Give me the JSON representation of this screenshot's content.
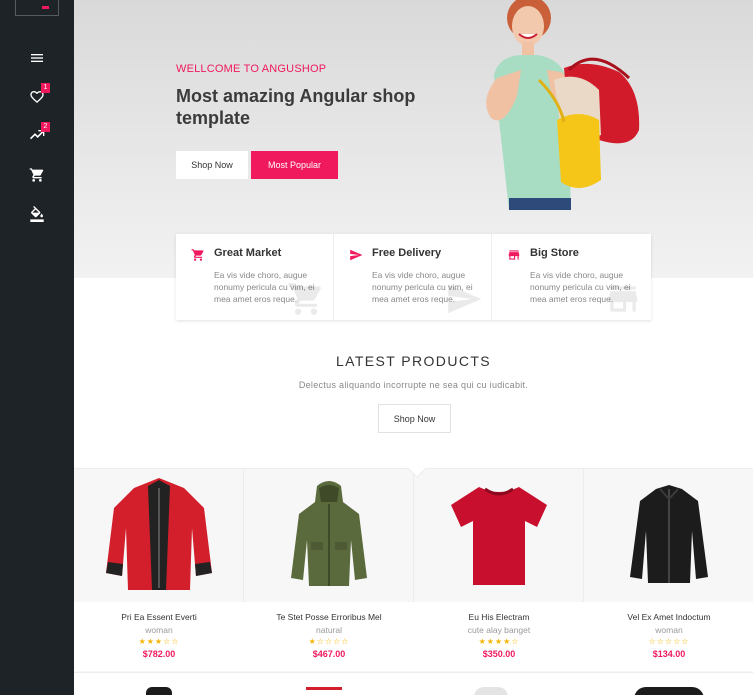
{
  "sidebar": {
    "items": [
      {
        "icon": "menu-icon"
      },
      {
        "icon": "heart-icon",
        "badge": "1"
      },
      {
        "icon": "trending-icon",
        "badge": "2"
      },
      {
        "icon": "cart-icon"
      },
      {
        "icon": "paint-bucket-icon"
      }
    ]
  },
  "hero": {
    "kicker": "WELLCOME TO ANGUSHOP",
    "title": "Most amazing Angular shop template",
    "btn_shop_now": "Shop Now",
    "btn_most_popular": "Most Popular"
  },
  "features": [
    {
      "icon": "cart-icon",
      "title": "Great Market",
      "text": "Ea vis vide choro, augue nonumy pericula cu vim, ei mea amet eros reque."
    },
    {
      "icon": "send-icon",
      "title": "Free Delivery",
      "text": "Ea vis vide choro, augue nonumy pericula cu vim, ei mea amet eros reque."
    },
    {
      "icon": "store-icon",
      "title": "Big Store",
      "text": "Ea vis vide choro, augue nonumy pericula cu vim, ei mea amet eros reque."
    }
  ],
  "latest": {
    "title": "LATEST PRODUCTS",
    "subtitle": "Delectus aliquando incorrupte ne sea qui cu iudicabit.",
    "button": "Shop Now"
  },
  "products": [
    {
      "name": "Pri Ea Essent Everti",
      "category": "woman",
      "rating": 3,
      "price": "$782.00",
      "image": "red-jacket"
    },
    {
      "name": "Te Stet Posse Erroribus Mel",
      "category": "natural",
      "rating": 1,
      "price": "$467.00",
      "image": "green-parka"
    },
    {
      "name": "Eu His Electram",
      "category": "cute alay banget",
      "rating": 4,
      "price": "$350.00",
      "image": "red-tshirt"
    },
    {
      "name": "Vel Ex Amet Indoctum",
      "category": "woman",
      "rating": 0,
      "price": "$134.00",
      "image": "black-jacket"
    }
  ],
  "colors": {
    "accent": "#f0195e",
    "sidebar": "#1e2328",
    "star": "#f5b400"
  }
}
